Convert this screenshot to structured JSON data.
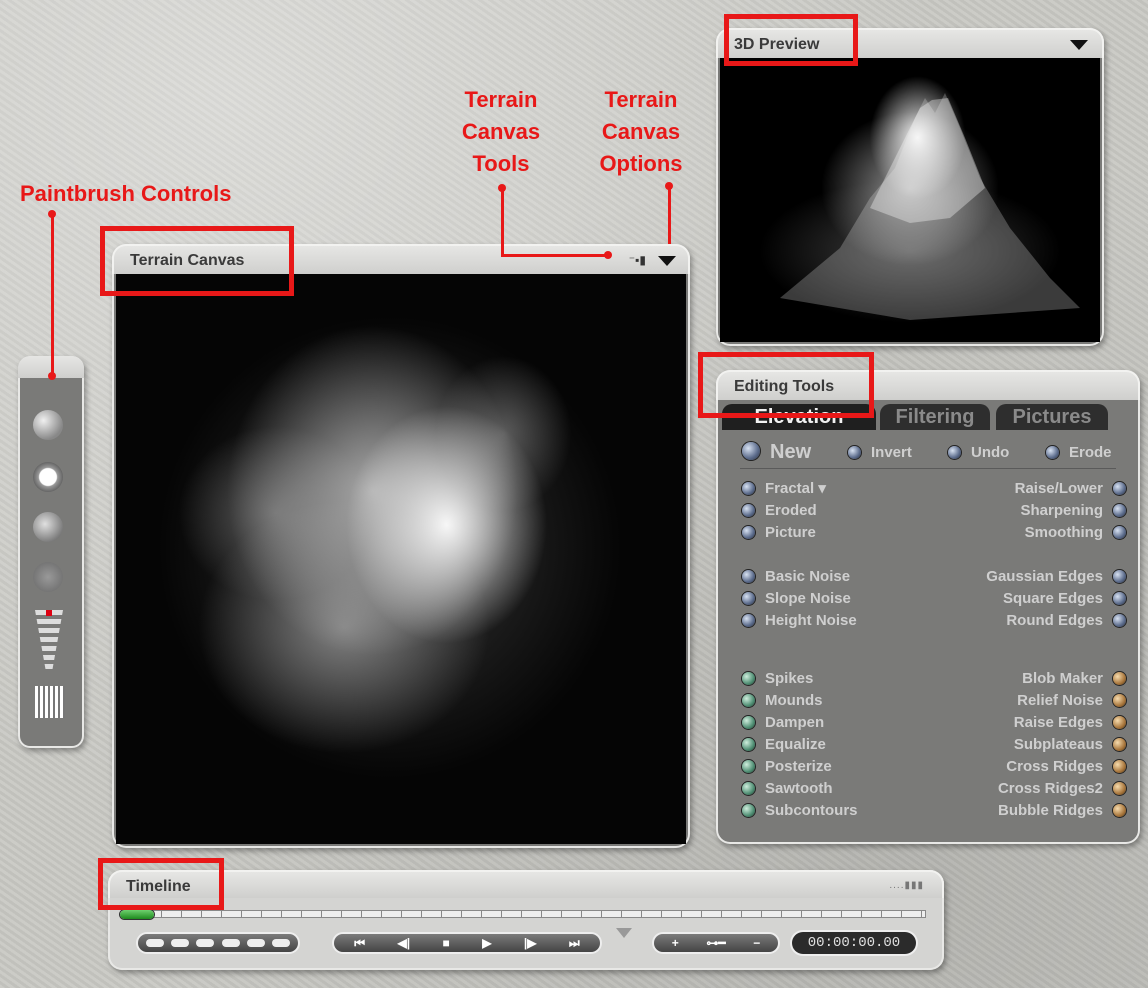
{
  "annotations": {
    "paintbrush_controls": "Paintbrush Controls",
    "terrain_canvas_tools": "Terrain\nCanvas\nTools",
    "terrain_canvas_options": "Terrain\nCanvas\nOptions"
  },
  "terrain_canvas": {
    "title": "Terrain Canvas",
    "tools_icon": "canvas-tools-icon",
    "options_icon": "triangle-down-icon"
  },
  "preview": {
    "title": "3D Preview",
    "menu_icon": "triangle-down-icon"
  },
  "editing_tools": {
    "title": "Editing Tools",
    "tabs": [
      "Elevation",
      "Filtering",
      "Pictures"
    ],
    "top_actions": [
      "New",
      "Invert",
      "Undo",
      "Erode"
    ],
    "left_group1": [
      "Fractal",
      "Eroded",
      "Picture"
    ],
    "right_group1": [
      "Raise/Lower",
      "Sharpening",
      "Smoothing"
    ],
    "left_group2": [
      "Basic Noise",
      "Slope Noise",
      "Height Noise"
    ],
    "right_group2": [
      "Gaussian Edges",
      "Square Edges",
      "Round Edges"
    ],
    "left_group3": [
      "Spikes",
      "Mounds",
      "Dampen",
      "Equalize",
      "Posterize",
      "Sawtooth",
      "Subcontours"
    ],
    "right_group3": [
      "Blob Maker",
      "Relief Noise",
      "Raise Edges",
      "Subplateaus",
      "Cross Ridges",
      "Cross Ridges2",
      "Bubble Ridges"
    ],
    "colors": {
      "blue": "#5a6a8a",
      "green": "#4f8e73",
      "orange": "#a8763c"
    }
  },
  "timeline": {
    "title": "Timeline",
    "time": "00:00:00.00",
    "transport": [
      "⏮",
      "◀|",
      "■",
      "▶",
      "|▶",
      "⏭"
    ],
    "key_controls": [
      "+",
      "key-icon",
      "−"
    ]
  },
  "colors": {
    "annotation_red": "#e81818",
    "panel_gray": "#7a7a78"
  }
}
